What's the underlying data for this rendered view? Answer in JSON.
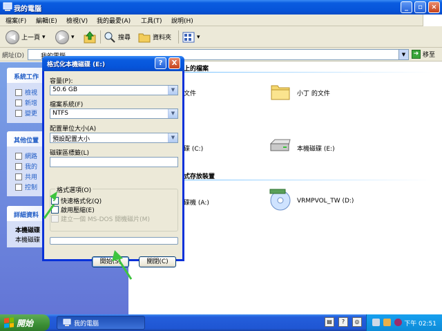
{
  "window": {
    "title": "我的電腦",
    "colors": {
      "titlebar": "#0a5ce0",
      "taskpane": "#6f8ee0",
      "start": "#3c8f35"
    }
  },
  "menu": [
    "檔案(F)",
    "編輯(E)",
    "檢視(V)",
    "我的最愛(A)",
    "工具(T)",
    "說明(H)"
  ],
  "toolbar": {
    "back": "上一頁",
    "search": "搜尋",
    "folders": "資料夾"
  },
  "address": {
    "label": "網址(D)",
    "value": "我的電腦",
    "go": "移至"
  },
  "taskpane": {
    "system": {
      "title": "系統工作",
      "items": [
        "檢視",
        "新增",
        "變更"
      ]
    },
    "other": {
      "title": "其他位置",
      "items": [
        "網路",
        "我的",
        "共用",
        "控制"
      ]
    },
    "details": {
      "title": "詳細資料",
      "name": "本機磁碟",
      "type": "本機磁碟"
    }
  },
  "content": {
    "shared_section": "上的檔案",
    "shared_left": "文件",
    "shared_folder": "小丁 的文件",
    "drive_c": "碟 (C:)",
    "drive_e": "本機磁碟 (E:)",
    "removable_section": "式存放裝置",
    "floppy": "碟機 (A:)",
    "cd": "VRMPVOL_TW (D:)"
  },
  "dialog": {
    "title": "格式化本機磁碟 (E:)",
    "help": "?",
    "close": "X",
    "capacity_label": "容量(P):",
    "capacity_value": "50.6 GB",
    "filesystem_label": "檔案系統(F)",
    "filesystem_value": "NTFS",
    "alloc_label": "配置單位大小(A)",
    "alloc_value": "預設配置大小",
    "volume_label": "磁碟區標籤(L)",
    "volume_value": "",
    "options_label": "格式選項(O)",
    "quick_format": "快速格式化(Q)",
    "quick_format_checked": true,
    "compression": "啟用壓縮(E)",
    "msdos": "建立一個 MS-DOS 開機磁片(M)",
    "progress": 0,
    "start_button": "開始(S)",
    "close_button": "關閉(C)"
  },
  "taskbar": {
    "start": "開始",
    "task": "我的電腦",
    "clock": "下午 02:51"
  }
}
